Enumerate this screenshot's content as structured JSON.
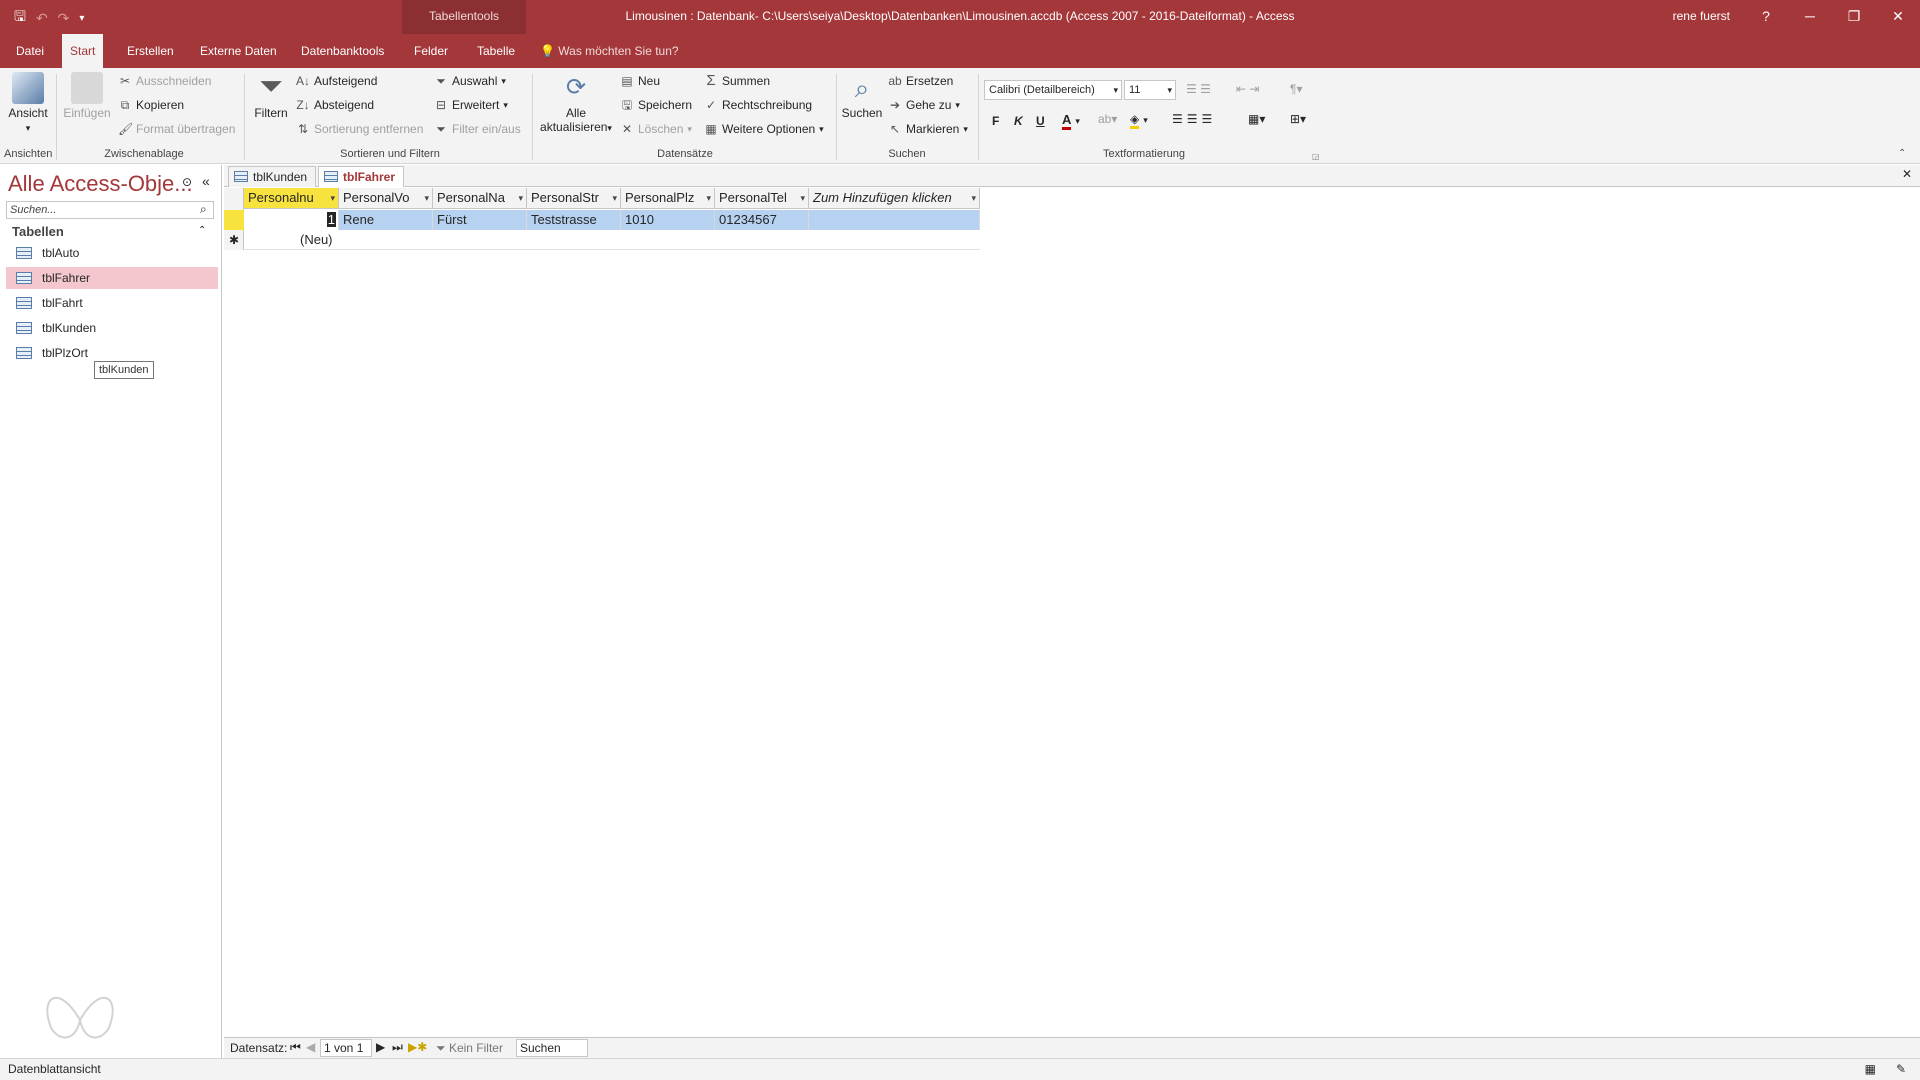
{
  "window": {
    "contextual_tab": "Tabellentools",
    "title": "Limousinen : Datenbank- C:\\Users\\seiya\\Desktop\\Datenbanken\\Limousinen.accdb (Access 2007 - 2016-Dateiformat)  -  Access",
    "user": "rene fuerst",
    "help": "?",
    "minimize": "─",
    "restore": "❐",
    "close": "✕"
  },
  "ribbon_tabs": [
    {
      "label": "Datei"
    },
    {
      "label": "Start"
    },
    {
      "label": "Erstellen"
    },
    {
      "label": "Externe Daten"
    },
    {
      "label": "Datenbanktools"
    },
    {
      "label": "Felder"
    },
    {
      "label": "Tabelle"
    }
  ],
  "tell_me": "Was möchten Sie tun?",
  "ribbon": {
    "ansichten": {
      "view": "Ansicht",
      "label": "Ansichten"
    },
    "zwischenablage": {
      "paste": "Einfügen",
      "cut": "Ausschneiden",
      "copy": "Kopieren",
      "format_painter": "Format übertragen",
      "label": "Zwischenablage"
    },
    "sortieren": {
      "filter": "Filtern",
      "ascending": "Aufsteigend",
      "descending": "Absteigend",
      "remove_sort": "Sortierung entfernen",
      "selection": "Auswahl",
      "advanced": "Erweitert",
      "toggle_filter": "Filter ein/aus",
      "label": "Sortieren und Filtern"
    },
    "datensaetze": {
      "refresh_line1": "Alle",
      "refresh_line2": "aktualisieren",
      "new": "Neu",
      "save": "Speichern",
      "delete": "Löschen",
      "totals": "Summen",
      "spelling": "Rechtschreibung",
      "more": "Weitere Optionen",
      "label": "Datensätze"
    },
    "suchen": {
      "find": "Suchen",
      "replace": "Ersetzen",
      "goto": "Gehe zu",
      "select": "Markieren",
      "label": "Suchen"
    },
    "text": {
      "font": "Calibri (Detailbereich)",
      "size": "11",
      "bold": "F",
      "italic": "K",
      "underline": "U",
      "label": "Textformatierung"
    }
  },
  "navpane": {
    "title": "Alle Access-Obje...",
    "search_placeholder": "Suchen...",
    "group": "Tabellen",
    "items": [
      {
        "label": "tblAuto"
      },
      {
        "label": "tblFahrer"
      },
      {
        "label": "tblFahrt"
      },
      {
        "label": "tblKunden"
      },
      {
        "label": "tblPlzOrt"
      }
    ],
    "tooltip": "tblKunden"
  },
  "doc_tabs": [
    {
      "label": "tblKunden"
    },
    {
      "label": "tblFahrer"
    }
  ],
  "datasheet": {
    "columns": [
      {
        "label": "Personalnu"
      },
      {
        "label": "PersonalVo"
      },
      {
        "label": "PersonalNa"
      },
      {
        "label": "PersonalStr"
      },
      {
        "label": "PersonalPlz"
      },
      {
        "label": "PersonalTel"
      },
      {
        "label": "Zum Hinzufügen klicken"
      }
    ],
    "row": [
      "1",
      "Rene",
      "Fürst",
      "Teststrasse",
      "1010",
      "01234567",
      ""
    ],
    "new_row": "(Neu)",
    "new_marker": "✱"
  },
  "record_nav": {
    "label": "Datensatz:",
    "position": "1 von 1",
    "filter": "Kein Filter",
    "search": "Suchen"
  },
  "status": "Datenblattansicht"
}
